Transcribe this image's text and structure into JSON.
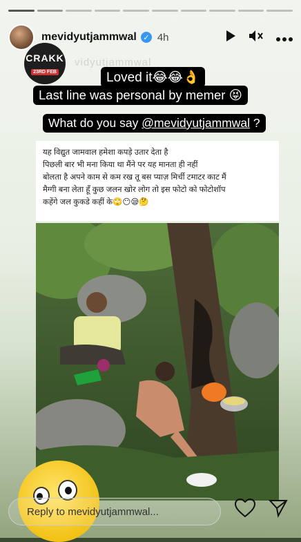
{
  "header": {
    "username": "mevidyutjammwal",
    "time": "4h",
    "verified": true
  },
  "watermark": {
    "name": "vidyutjammwal",
    "sticker_title": "CRAKK",
    "sticker_date": "23RD FEB"
  },
  "captions": {
    "line1": "Loved it😂😂👌",
    "line2": "Last line was personal by memer 😝",
    "line3_prefix": "What do you say ",
    "line3_mention": "@mevidyutjammwal",
    "line3_suffix": " ?"
  },
  "meme": {
    "lines": [
      "यह विद्युत जामवाल हमेशा कपड़े उतार देता है",
      "पिछली बार भी मना किया था मैंने पर यह मानता ही नहीं",
      "बोलता है अपने काम से कम रख तू बस प्याज़ मिर्ची टमाटर काट मैं",
      "मैग्गी बना लेता हूँ कुछ जलन खोर लोग तो इस फोटो को फोटोशॉप",
      "कहेंगे जल कुकडे कहीं के🙄😶😪🤔"
    ]
  },
  "footer": {
    "reply_placeholder": "Reply to mevidyutjammwal..."
  },
  "colors": {
    "bubble_bg": "#000000",
    "bubble_text": "#ffffff",
    "verified_badge": "#3897f0"
  },
  "icons": [
    "play-icon",
    "mute-icon",
    "more-icon",
    "verified-icon",
    "heart-icon",
    "send-icon"
  ]
}
